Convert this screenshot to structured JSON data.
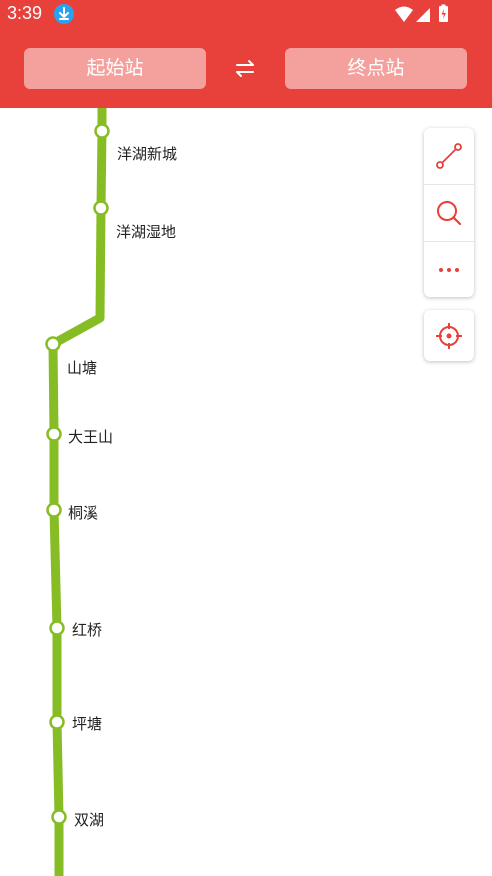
{
  "status_bar": {
    "time": "3:39",
    "icons": [
      "download-icon",
      "wifi-icon",
      "signal-icon",
      "battery-icon"
    ]
  },
  "header": {
    "start_label": "起始站",
    "end_label": "终点站",
    "swap_icon": "swap-icon"
  },
  "colors": {
    "header": "#e8403a",
    "button": "#f4a19d",
    "line": "#86bd25",
    "tool_icon": "#e8403a"
  },
  "stations": [
    {
      "name": "洋湖新城"
    },
    {
      "name": "洋湖湿地"
    },
    {
      "name": "山塘"
    },
    {
      "name": "大王山"
    },
    {
      "name": "桐溪"
    },
    {
      "name": "红桥"
    },
    {
      "name": "坪塘"
    },
    {
      "name": "双湖"
    }
  ],
  "tools": [
    "route-icon",
    "search-icon",
    "more-icon",
    "locate-icon"
  ]
}
